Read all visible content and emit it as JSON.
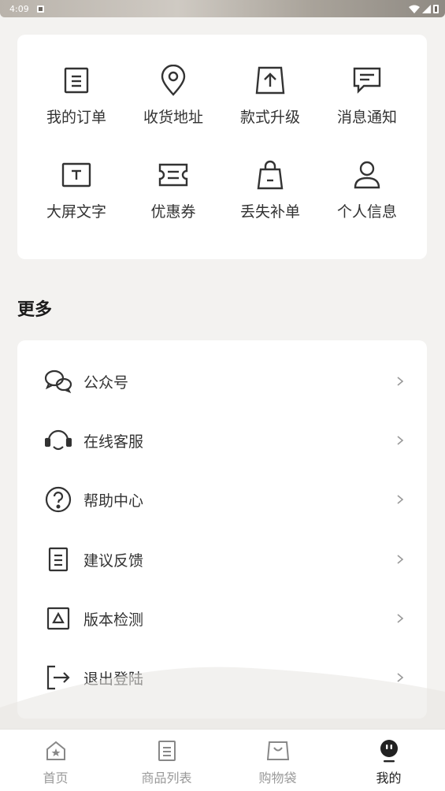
{
  "status_bar": {
    "time": "4:09"
  },
  "grid": {
    "items": [
      {
        "label": "我的订单",
        "icon": "order-icon"
      },
      {
        "label": "收货地址",
        "icon": "location-icon"
      },
      {
        "label": "款式升级",
        "icon": "upgrade-icon"
      },
      {
        "label": "消息通知",
        "icon": "message-icon"
      },
      {
        "label": "大屏文字",
        "icon": "big-text-icon"
      },
      {
        "label": "优惠券",
        "icon": "coupon-icon"
      },
      {
        "label": "丢失补单",
        "icon": "bag-icon"
      },
      {
        "label": "个人信息",
        "icon": "user-icon"
      }
    ]
  },
  "more": {
    "title": "更多",
    "items": [
      {
        "label": "公众号",
        "icon": "wechat-icon"
      },
      {
        "label": "在线客服",
        "icon": "headset-icon"
      },
      {
        "label": "帮助中心",
        "icon": "help-icon"
      },
      {
        "label": "建议反馈",
        "icon": "feedback-icon"
      },
      {
        "label": "版本检测",
        "icon": "version-icon"
      },
      {
        "label": "退出登陆",
        "icon": "logout-icon"
      }
    ]
  },
  "tabs": [
    {
      "label": "首页",
      "icon": "home-icon",
      "active": false
    },
    {
      "label": "商品列表",
      "icon": "list-icon",
      "active": false
    },
    {
      "label": "购物袋",
      "icon": "shopping-bag-icon",
      "active": false
    },
    {
      "label": "我的",
      "icon": "mine-icon",
      "active": true
    }
  ],
  "colors": {
    "accent": "#222222",
    "inactive": "#999999",
    "icon": "#333333",
    "background": "#f3f2f0"
  }
}
